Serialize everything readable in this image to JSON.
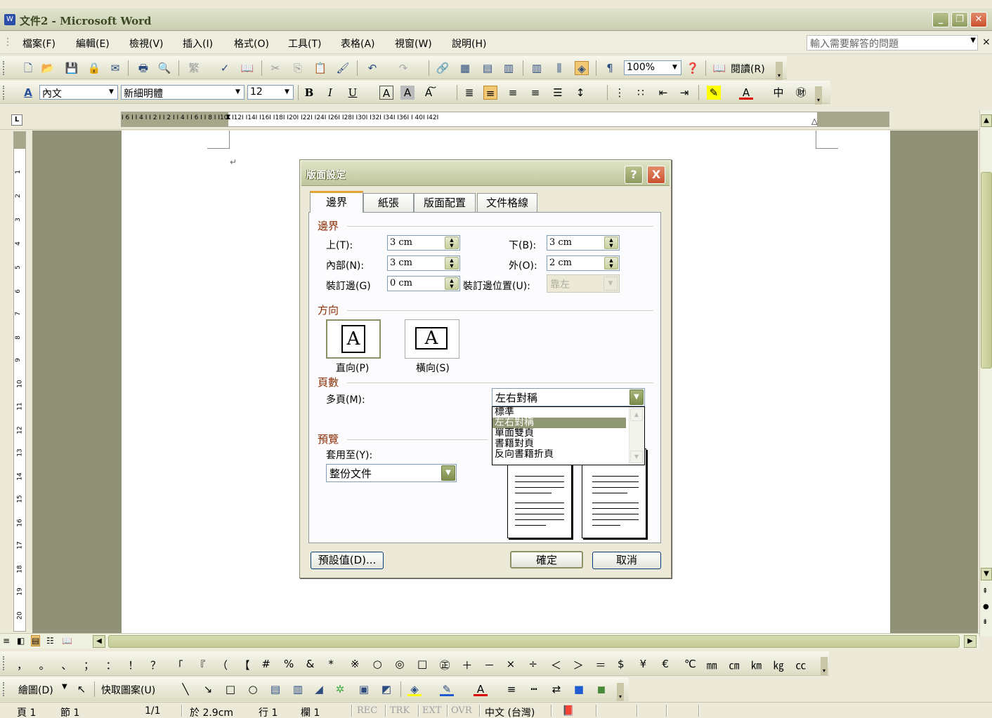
{
  "window": {
    "title": "文件2 - Microsoft Word",
    "controls": [
      "minimize-icon",
      "restore-icon",
      "close-icon"
    ]
  },
  "menubar": {
    "items": [
      "檔案(F)",
      "編輯(E)",
      "檢視(V)",
      "插入(I)",
      "格式(O)",
      "工具(T)",
      "表格(A)",
      "視窗(W)",
      "說明(H)"
    ],
    "ask_placeholder": "輸入需要解答的問題",
    "close_glyph": "×"
  },
  "standard_toolbar": {
    "zoom": "100%",
    "read_label": "閱讀(R)"
  },
  "format_toolbar": {
    "style": "內文",
    "font": "新細明體",
    "size": "12",
    "bold": "B",
    "italic": "I",
    "underline": "U"
  },
  "ruler": {
    "numbers": "I 6 I  I 4 I  I 2 I      I 2 I  I 4 I  I 6 I  I 8 I  I10I  I12I  I14I  I16I  I18I  I20I  I22I  I24I  I26I  I28I  I30I  I32I  I34I  I36I      I 40I  I42I",
    "vertical": [
      "1",
      "2",
      "3",
      "4",
      "5",
      "6",
      "7",
      "8",
      "9",
      "10",
      "11",
      "12",
      "13",
      "14",
      "15",
      "16",
      "17",
      "18",
      "19",
      "20"
    ],
    "tab_selector": "L"
  },
  "document": {
    "para_mark": "↵"
  },
  "dialog": {
    "title": "版面設定",
    "help_glyph": "?",
    "close_glyph": "X",
    "tabs": [
      "邊界",
      "紙張",
      "版面配置",
      "文件格線"
    ],
    "active_tab": "邊界",
    "margins": {
      "group_label": "邊界",
      "top_label": "上(T):",
      "top_value": "3 cm",
      "bottom_label": "下(B):",
      "bottom_value": "3 cm",
      "inside_label": "內部(N):",
      "inside_value": "3 cm",
      "outside_label": "外(O):",
      "outside_value": "2 cm",
      "gutter_label": "裝訂邊(G)",
      "gutter_value": "0 cm",
      "gutter_pos_label": "裝訂邊位置(U):",
      "gutter_pos_value": "靠左"
    },
    "orientation": {
      "group_label": "方向",
      "portrait_label": "直向(P)",
      "landscape_label": "橫向(S)",
      "glyph": "A",
      "selected": "portrait"
    },
    "pages": {
      "group_label": "頁數",
      "multiple_label": "多頁(M):",
      "selected": "左右對稱",
      "options": [
        "標準",
        "左右對稱",
        "單面雙頁",
        "書籍對頁",
        "反向書籍折頁"
      ]
    },
    "preview": {
      "group_label": "預覽",
      "apply_label": "套用至(Y):",
      "apply_value": "整份文件"
    },
    "buttons": {
      "default": "預設值(D)...",
      "ok": "確定",
      "cancel": "取消"
    }
  },
  "symbol_toolbar": {
    "symbols": [
      "，",
      "。",
      "、",
      "；",
      "：",
      "！",
      "？",
      "「",
      "『",
      "（",
      "【",
      "#",
      "%",
      "&",
      "*",
      "※",
      "○",
      "◎",
      "□",
      "㊣",
      "＋",
      "－",
      "×",
      "÷",
      "＜",
      "＞",
      "＝",
      "$",
      "¥",
      "€",
      "℃",
      "㎜",
      "㎝",
      "㎞",
      "㎏",
      "㏄"
    ]
  },
  "drawing_toolbar": {
    "draw_label": "繪圖(D)",
    "autoshape_label": "快取圖案(U)"
  },
  "statusbar": {
    "page": "頁 1",
    "section": "節 1",
    "pages": "1/1",
    "at": "於 2.9cm",
    "line": "行 1",
    "col": "欄 1",
    "rec": "REC",
    "trk": "TRK",
    "ext": "EXT",
    "ovr": "OVR",
    "language": "中文 (台灣)"
  }
}
